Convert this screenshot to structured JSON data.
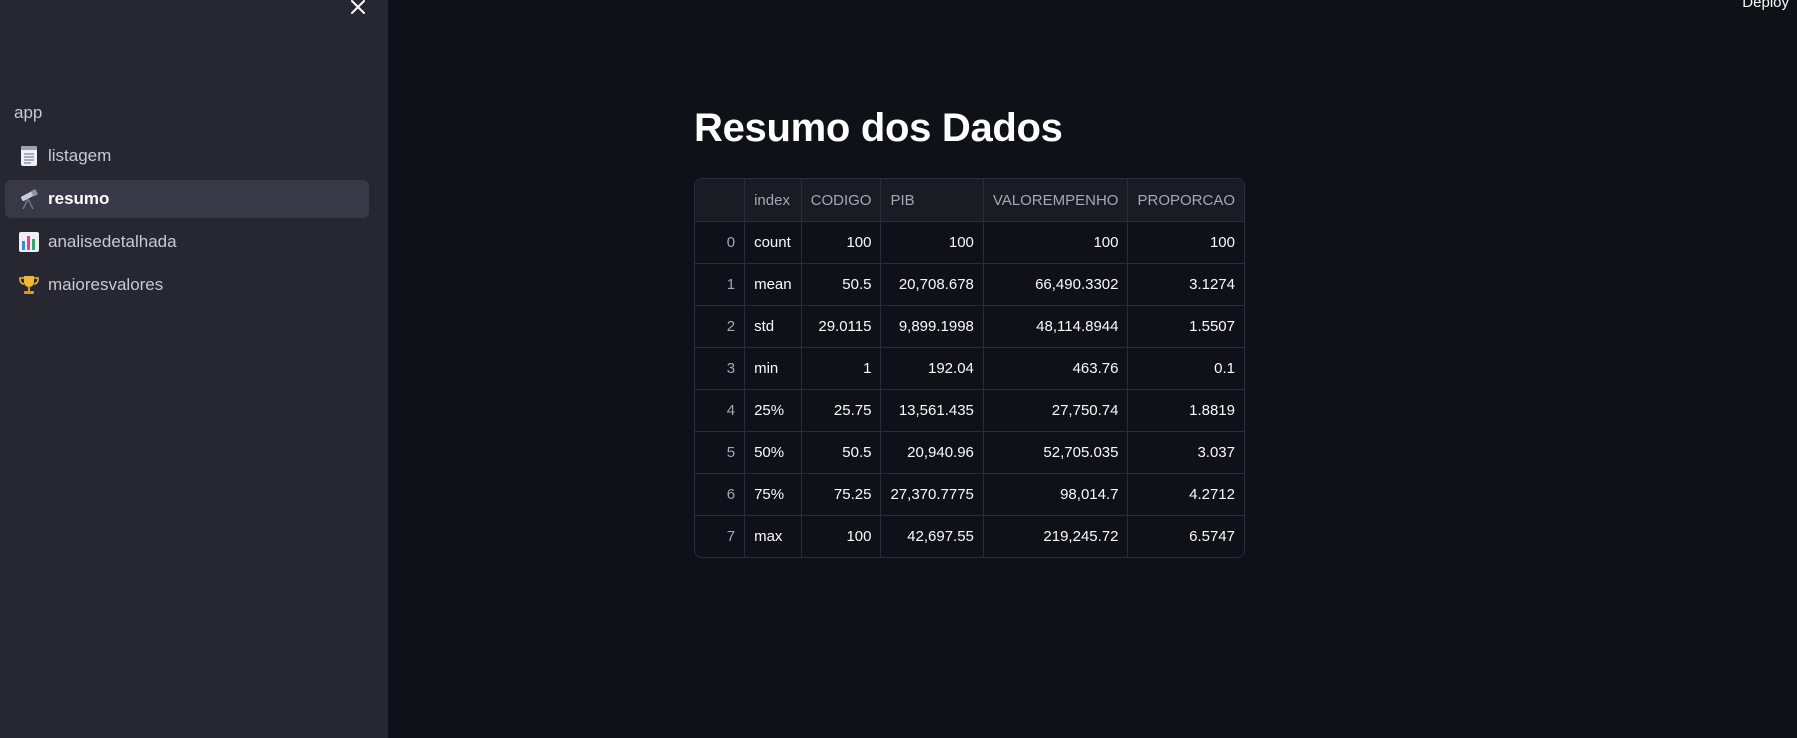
{
  "header": {
    "deploy_label": "Deploy"
  },
  "sidebar": {
    "title": "app",
    "items": [
      {
        "icon": "memo-icon",
        "label": "listagem",
        "active": false
      },
      {
        "icon": "telescope-icon",
        "label": "resumo",
        "active": true
      },
      {
        "icon": "bar-chart-icon",
        "label": "analisedetalhada",
        "active": false
      },
      {
        "icon": "trophy-icon",
        "label": "maioresvalores",
        "active": false
      }
    ]
  },
  "main": {
    "title": "Resumo dos Dados",
    "table": {
      "columns": [
        "",
        "index",
        "CODIGO",
        "PIB",
        "VALOREMPENHO",
        "PROPORCAO"
      ],
      "rows": [
        [
          "0",
          "count",
          "100",
          "100",
          "100",
          "100"
        ],
        [
          "1",
          "mean",
          "50.5",
          "20,708.678",
          "66,490.3302",
          "3.1274"
        ],
        [
          "2",
          "std",
          "29.0115",
          "9,899.1998",
          "48,114.8944",
          "1.5507"
        ],
        [
          "3",
          "min",
          "1",
          "192.04",
          "463.76",
          "0.1"
        ],
        [
          "4",
          "25%",
          "25.75",
          "13,561.435",
          "27,750.74",
          "1.8819"
        ],
        [
          "5",
          "50%",
          "50.5",
          "20,940.96",
          "52,705.035",
          "3.037"
        ],
        [
          "6",
          "75%",
          "75.25",
          "27,370.7775",
          "98,014.7",
          "4.2712"
        ],
        [
          "7",
          "max",
          "100",
          "42,697.55",
          "219,245.72",
          "6.5747"
        ]
      ]
    }
  },
  "colors": {
    "background": "#0e1117",
    "sidebar": "#262730",
    "active_item": "#373946",
    "border": "#2b2e38"
  }
}
